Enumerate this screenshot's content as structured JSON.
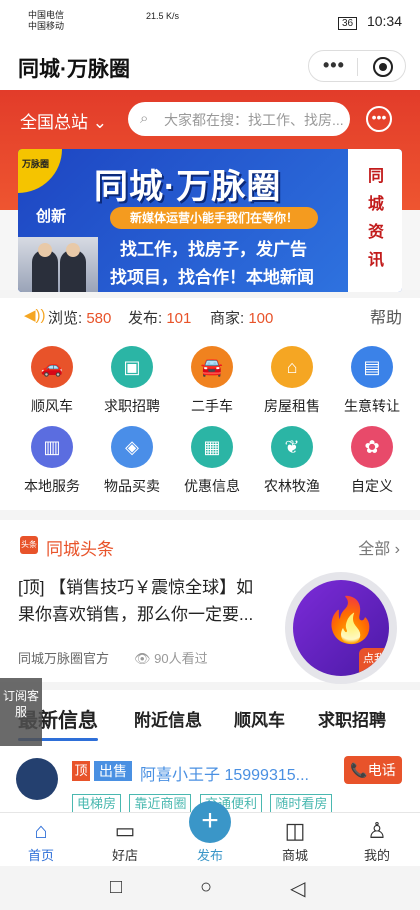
{
  "status": {
    "carrier1": "中国电信",
    "carrier2": "中国移动",
    "net": "21.5 K/s",
    "battery": "36",
    "time": "10:34"
  },
  "title": "同城·万脉圈",
  "capsule": {
    "more": "•••"
  },
  "region": "全国总站",
  "search_placeholder": "大家都在搜：找工作、找房...",
  "banner": {
    "corner": "万脉圈",
    "title": "同城·万脉圈",
    "tag": "创新",
    "pill": "新媒体运营小能手我们在等你！",
    "line2": "找工作，找房子，发广告",
    "line3": "找项目，找合作！本地新闻",
    "side": "同城资讯"
  },
  "stats": {
    "view_label": "浏览:",
    "view": "580",
    "post_label": "发布:",
    "post": "101",
    "shop_label": "商家:",
    "shop": "100",
    "help": "帮助"
  },
  "grid": [
    {
      "label": "顺风车",
      "color": "#e8532a",
      "glyph": "🚗"
    },
    {
      "label": "求职招聘",
      "color": "#2bb5a5",
      "glyph": "▣"
    },
    {
      "label": "二手车",
      "color": "#f0821f",
      "glyph": "🚘"
    },
    {
      "label": "房屋租售",
      "color": "#f5a623",
      "glyph": "⌂"
    },
    {
      "label": "生意转让",
      "color": "#3b82e8",
      "glyph": "▤"
    },
    {
      "label": "本地服务",
      "color": "#5b6de0",
      "glyph": "▥"
    },
    {
      "label": "物品买卖",
      "color": "#4a8ee8",
      "glyph": "◈"
    },
    {
      "label": "优惠信息",
      "color": "#2bb5a5",
      "glyph": "▦"
    },
    {
      "label": "农林牧渔",
      "color": "#2bb5a5",
      "glyph": "❦"
    },
    {
      "label": "自定义",
      "color": "#e84a6a",
      "glyph": "✿"
    }
  ],
  "news": {
    "logo": "头条",
    "title": "同城头条",
    "all": "全部 ›",
    "headline": "[顶] 【销售技巧￥震惊全球】如果你喜欢销售，那么你一定要...",
    "source": "同城万脉圈官方",
    "views": "90人看过",
    "sign": "点我签到"
  },
  "subscribe": "订阅客服",
  "tabs": [
    "最新信息",
    "附近信息",
    "顺风车",
    "求职招聘"
  ],
  "post": {
    "top": "顶",
    "sell": "出售",
    "user": "阿喜小王子 15999315...",
    "phone": "电话",
    "tags": [
      "电梯房",
      "靠近商圈",
      "交通便利",
      "随时看房"
    ]
  },
  "nav": [
    {
      "label": "首页",
      "glyph": "⌂"
    },
    {
      "label": "好店",
      "glyph": "▭"
    },
    {
      "label": "发布",
      "glyph": "+"
    },
    {
      "label": "商城",
      "glyph": "◫"
    },
    {
      "label": "我的",
      "glyph": "♙"
    }
  ],
  "sys": {
    "square": "□",
    "circle": "○",
    "back": "◁"
  }
}
